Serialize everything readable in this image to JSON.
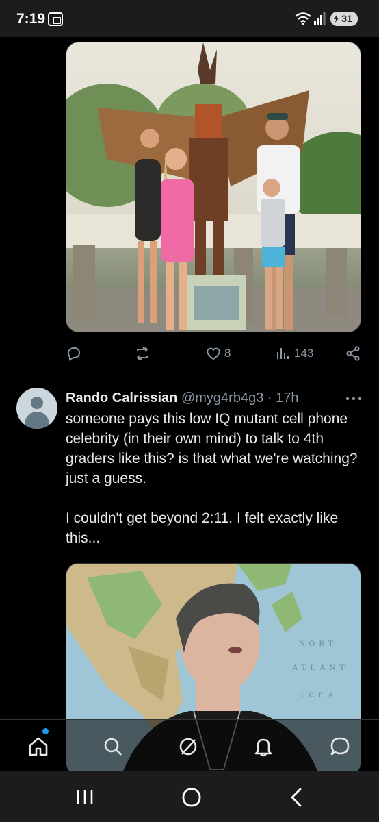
{
  "status_bar": {
    "time": "7:19",
    "battery": "31"
  },
  "top_post": {
    "actions": {
      "replies": "",
      "reposts": "",
      "likes": "8",
      "views": "143"
    }
  },
  "post": {
    "display_name": "Rando Calrissian",
    "handle": "@myg4rb4g3",
    "separator": "·",
    "time": "17h",
    "text": "someone pays this low IQ mutant cell phone celebrity (in their own mind) to talk to 4th graders like this? is that what we're watching? just a guess.\n\nI couldn't get beyond 2:11. I felt exactly like this..."
  },
  "bottom_nav": {
    "items": [
      "home-icon",
      "search-icon",
      "grok-icon",
      "notifications-icon",
      "messages-icon"
    ]
  },
  "colors": {
    "background": "#000000",
    "text_primary": "#e7e9ea",
    "text_secondary": "#8b98a5",
    "accent": "#1d9bf0",
    "divider": "#2f3336"
  }
}
